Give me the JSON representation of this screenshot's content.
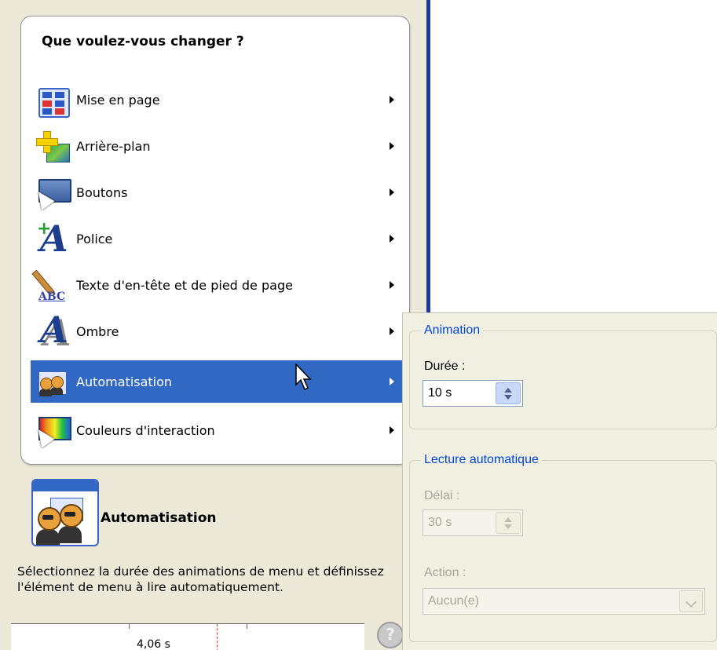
{
  "menu": {
    "title": "Que voulez-vous changer ?",
    "items": [
      {
        "label": "Mise en page",
        "icon": "layout-icon"
      },
      {
        "label": "Arrière-plan",
        "icon": "background-icon"
      },
      {
        "label": "Boutons",
        "icon": "buttons-icon"
      },
      {
        "label": "Police",
        "icon": "font-icon"
      },
      {
        "label": "Texte d'en-tête et de pied de page",
        "icon": "header-footer-text-icon"
      },
      {
        "label": "Ombre",
        "icon": "shadow-icon"
      },
      {
        "label": "Automatisation",
        "icon": "automation-icon",
        "selected": true
      },
      {
        "label": "Couleurs d'interaction",
        "icon": "interaction-colors-icon"
      }
    ]
  },
  "details": {
    "title": "Automatisation",
    "description": "Sélectionnez la durée des animations de menu et définissez l'élément de menu à lire automatiquement."
  },
  "timeline": {
    "label": "4,06 s"
  },
  "animation": {
    "legend": "Animation",
    "duration_label": "Durée :",
    "duration_value": "10 s"
  },
  "autoplay": {
    "legend": "Lecture automatique",
    "delay_label": "Délai :",
    "delay_value": "30 s",
    "action_label": "Action :",
    "action_value": "Aucun(e)"
  },
  "colors": {
    "selection": "#3168c4",
    "legend": "#0046d5",
    "disabled_text": "#a8a699"
  }
}
